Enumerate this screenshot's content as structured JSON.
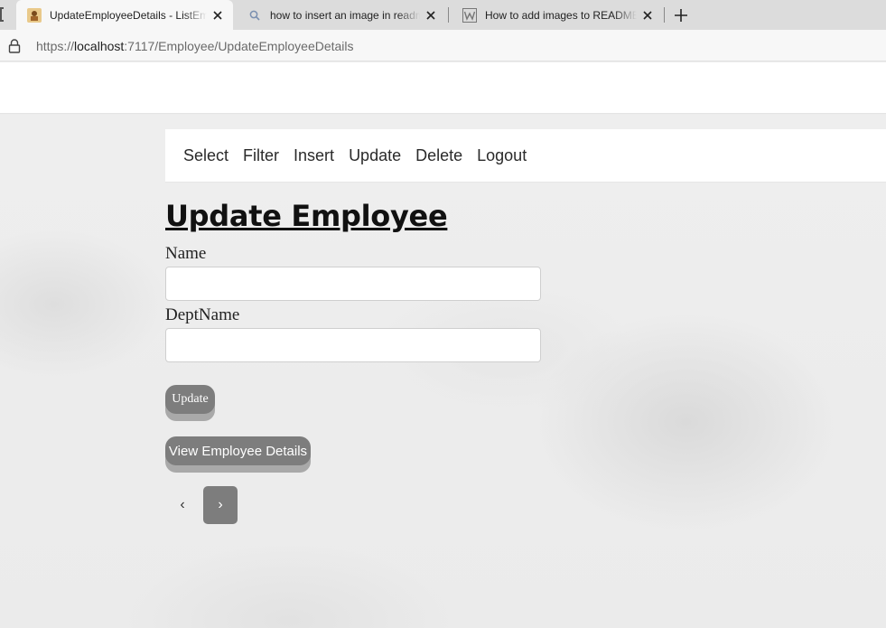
{
  "browser": {
    "tabs": [
      {
        "title": "UpdateEmployeeDetails - ListEmployee",
        "active": true,
        "favicon": "app-favicon-icon"
      },
      {
        "title": "how to insert an image in readme",
        "active": false,
        "favicon": "search-icon"
      },
      {
        "title": "How to add images to README.md",
        "active": false,
        "favicon": "wikihow-icon"
      }
    ],
    "url": {
      "scheme": "https://",
      "host": "localhost",
      "rest": ":7117/Employee/UpdateEmployeeDetails"
    }
  },
  "nav": {
    "items": [
      "Select",
      "Filter",
      "Insert",
      "Update",
      "Delete",
      "Logout"
    ]
  },
  "form": {
    "title": "Update Employee",
    "name_label": "Name",
    "name_value": "",
    "dept_label": "DeptName",
    "dept_value": "",
    "submit_label": "Update",
    "view_label": "View Employee Details"
  },
  "pager": {
    "prev": "‹",
    "next": "›"
  },
  "colors": {
    "button": "#7d7d7d",
    "button_shadow": "#a9a9a9",
    "background": "#ececec"
  }
}
